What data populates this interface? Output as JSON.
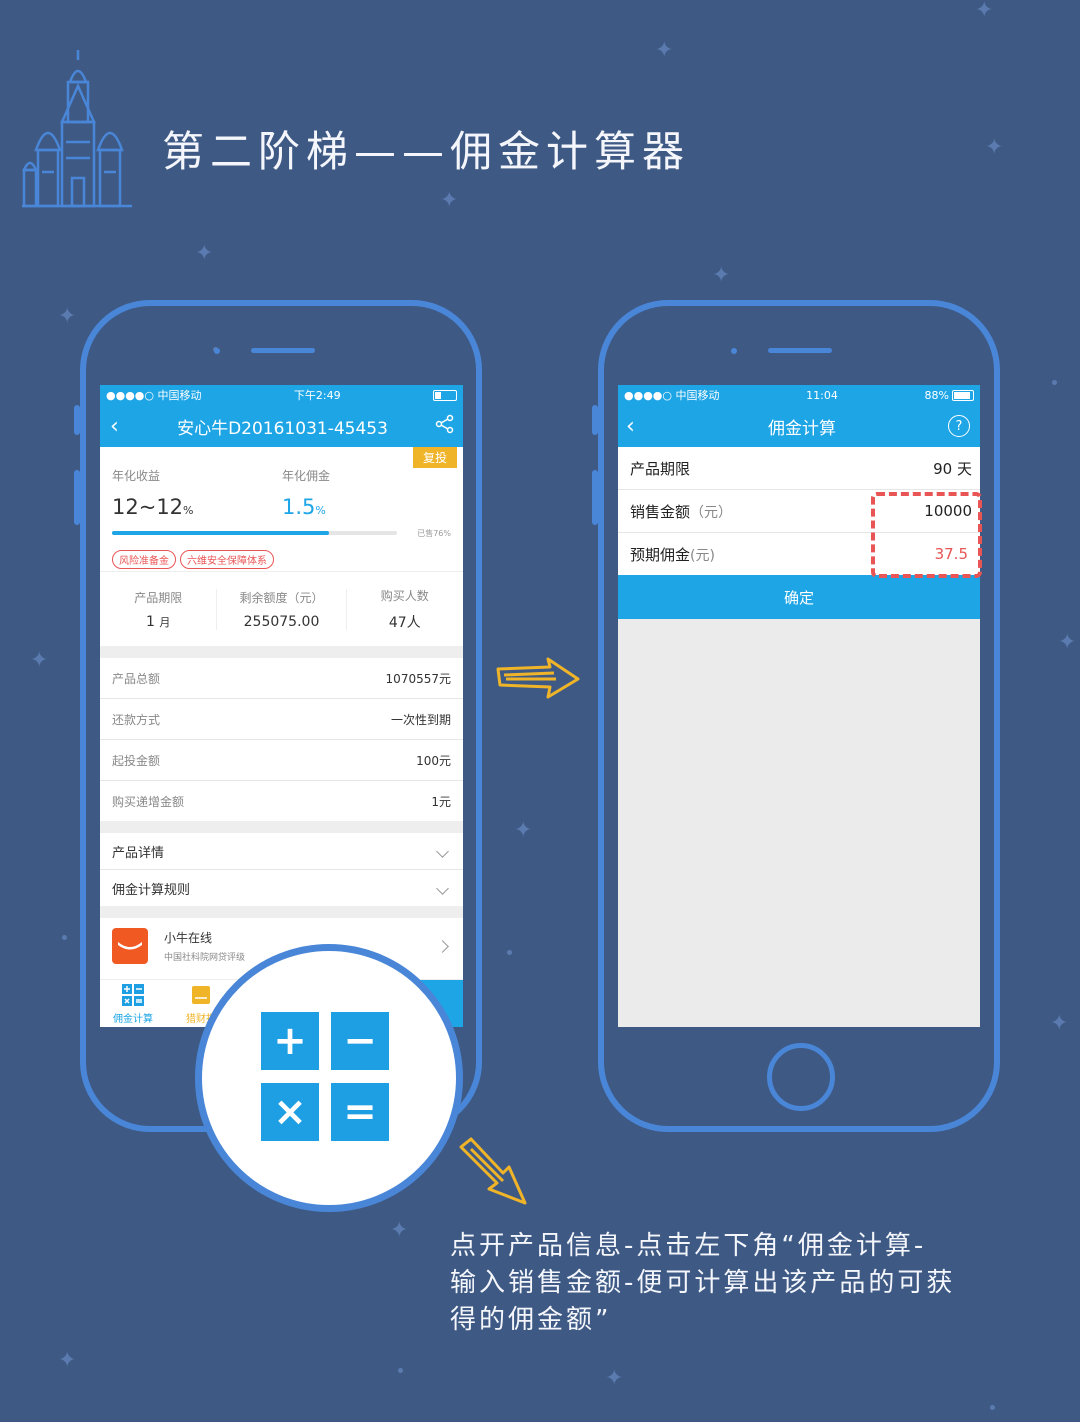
{
  "heading": "第二阶梯——佣金计算器",
  "phone1": {
    "status": {
      "carrier": "●●●●○ 中国移动",
      "time": "下午2:49"
    },
    "nav_title": "安心牛D20161031-45453",
    "badge": "复投",
    "yield_label": "年化收益",
    "yield_value": "12~12",
    "yield_unit": "%",
    "commission_label": "年化佣金",
    "commission_value": "1.5",
    "commission_unit": "%",
    "sold_text": "已售76%",
    "sold_fraction": 0.76,
    "tags": [
      "风险准备金",
      "六维安全保障体系"
    ],
    "stats": [
      {
        "label": "产品期限",
        "value": "1",
        "unit": "月"
      },
      {
        "label": "剩余额度（元）",
        "value": "255075.00",
        "unit": ""
      },
      {
        "label": "购买人数",
        "value": "47人",
        "unit": ""
      }
    ],
    "details": [
      {
        "label": "产品总额",
        "value": "1070557元"
      },
      {
        "label": "还款方式",
        "value": "一次性到期"
      },
      {
        "label": "起投金额",
        "value": "100元"
      },
      {
        "label": "购买递增金额",
        "value": "1元"
      }
    ],
    "expand_rows": [
      "产品详情",
      "佣金计算规则"
    ],
    "company": {
      "name": "小牛在线",
      "desc": "中国社科院网贷评级"
    },
    "tabbar": {
      "calc_label": "佣金计算",
      "second_label": "猎财报"
    }
  },
  "phone2": {
    "status": {
      "carrier": "●●●●○ 中国移动",
      "time": "11:04",
      "battery": "88%"
    },
    "nav_title": "佣金计算",
    "help_icon": "?",
    "rows": [
      {
        "label": "产品期限",
        "unit": "",
        "value": "90 天"
      },
      {
        "label": "销售金额",
        "unit": "（元）",
        "value": "10000"
      },
      {
        "label": "预期佣金",
        "unit": "(元)",
        "value": "37.5"
      }
    ],
    "confirm_label": "确定"
  },
  "calculator_keys": [
    "+",
    "−",
    "×",
    "="
  ],
  "caption_lines": [
    "点开产品信息-点击左下角“佣金计算-",
    "输入销售金额-便可计算出该产品的可获",
    "得的佣金额”"
  ],
  "colors": {
    "background": "#3e5a84",
    "phone_frame": "#4a86d8",
    "app_blue": "#1ea5e6",
    "highlight": "#e95454",
    "arrow": "#f0b429"
  }
}
